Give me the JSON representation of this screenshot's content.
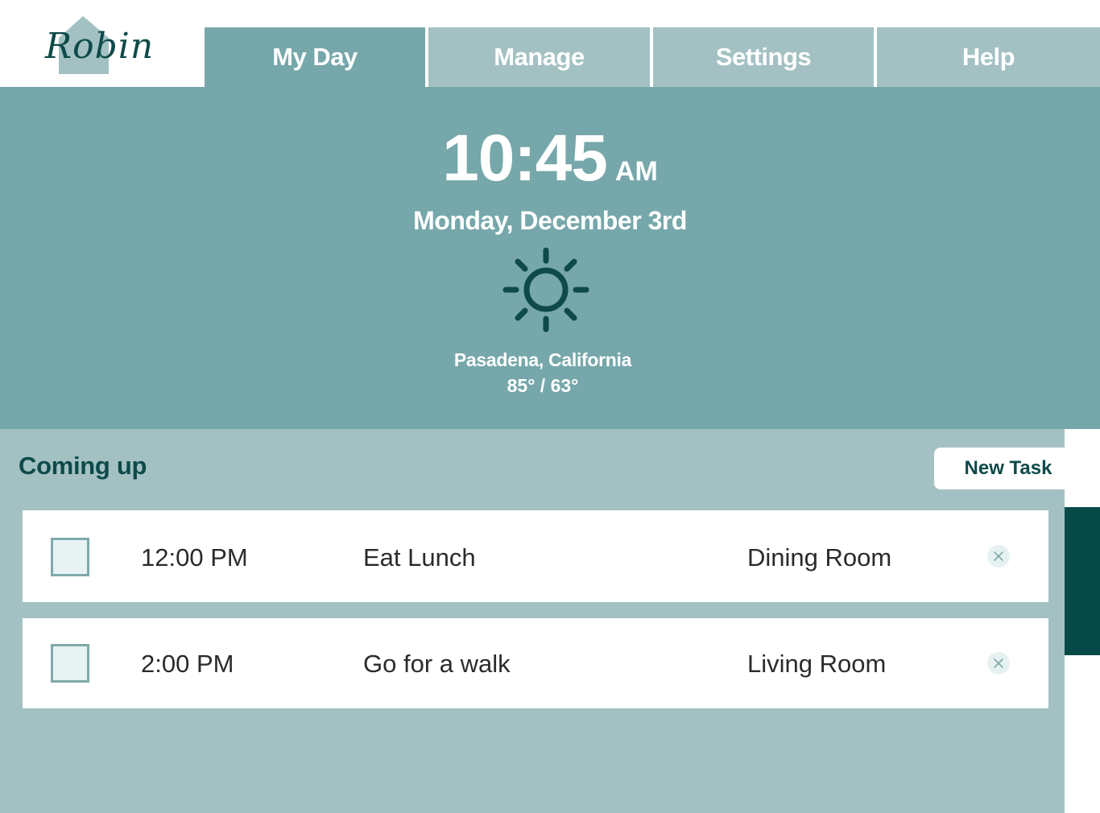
{
  "app": {
    "logo_text": "Robin"
  },
  "nav": {
    "tabs": [
      {
        "label": "My Day",
        "active": true
      },
      {
        "label": "Manage",
        "active": false
      },
      {
        "label": "Settings",
        "active": false
      },
      {
        "label": "Help",
        "active": false
      }
    ]
  },
  "hero": {
    "time": "10:45",
    "ampm": "AM",
    "date": "Monday, December 3rd",
    "weather_icon": "sun-icon",
    "location": "Pasadena, California",
    "temps": "85° / 63°"
  },
  "coming_up": {
    "title": "Coming up",
    "new_task_label": "New Task",
    "tasks": [
      {
        "time": "12:00 PM",
        "name": "Eat Lunch",
        "room": "Dining Room",
        "done": false
      },
      {
        "time": "2:00 PM",
        "name": "Go for a walk",
        "room": "Living Room",
        "done": false
      }
    ]
  },
  "colors": {
    "primary": "#76a7aa",
    "secondary": "#a3c1c3",
    "dark": "#0e4a49",
    "scroll_thumb": "#064a48"
  }
}
